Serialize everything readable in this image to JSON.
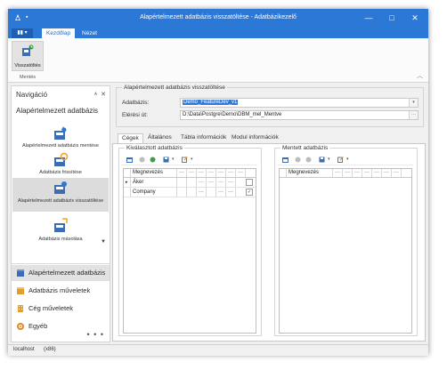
{
  "window": {
    "title": "Alapértelmezett adatbázis visszatöltése - Adatbázikezelő",
    "quick_access": "▪",
    "controls": {
      "minimize": "—",
      "maximize": "□",
      "close": "✕"
    }
  },
  "ribbon": {
    "file_label": "▮▮ ▾",
    "tabs": [
      {
        "label": "Kezdőlap"
      },
      {
        "label": "Nézet"
      }
    ],
    "button_label": "Visszatöltés",
    "group_label": "Mentés",
    "collapse_glyph": "︿"
  },
  "navigation": {
    "header": "Navigáció",
    "pin_glyph": "ᴀ",
    "close_glyph": "✕",
    "section": "Alapértelmezett adatbázis",
    "items": [
      {
        "label": "Alapértelmezett adatbázis mentése"
      },
      {
        "label": "Adatbázis frissítése"
      },
      {
        "label": "Alapértelmezett adatbázis visszatöltése"
      },
      {
        "label": "Adatbázis másolása"
      }
    ],
    "scroll_glyph": "▼",
    "groups": [
      {
        "label": "Alapértelmezett adatbázis"
      },
      {
        "label": "Adatbázis műveletek"
      },
      {
        "label": "Cég műveletek"
      },
      {
        "label": "Egyéb"
      }
    ],
    "more": "• • •"
  },
  "form": {
    "group_title": "Alapértelmezett adatbázis visszatöltése",
    "db_label": "Adatbázis:",
    "db_value": "Demo_FeatureDev_v1",
    "path_label": "Elérési út:",
    "path_value": "D:\\Data\\Postgre\\Demo\\DBM_mel_Mentve",
    "browse": "···"
  },
  "tabs": [
    {
      "label": "Cégek"
    },
    {
      "label": "Általános"
    },
    {
      "label": "Tábla információk"
    },
    {
      "label": "Modul információk"
    }
  ],
  "selected_panel": {
    "title": "Kiválasztott adatbázis",
    "header": [
      "Megnevezés",
      "···",
      "···",
      "···",
      "···",
      "···",
      "···",
      "···"
    ],
    "rows": [
      {
        "indicator": "▸",
        "name": "Áker",
        "dots": [
          "···",
          "···",
          "···",
          "···"
        ],
        "checked": false
      },
      {
        "indicator": "",
        "name": "Company",
        "dots": [
          "···",
          "···",
          "···"
        ],
        "checked": true
      }
    ]
  },
  "saved_panel": {
    "title": "Mentett adatbázis",
    "header": [
      "Megnevezés",
      "···",
      "···",
      "···",
      "···",
      "···",
      "···",
      "···"
    ]
  },
  "status": {
    "server": "localhost",
    "arch": "(x86)"
  },
  "colors": {
    "title_blue": "#2b78d7",
    "selection": "#3479d6"
  }
}
